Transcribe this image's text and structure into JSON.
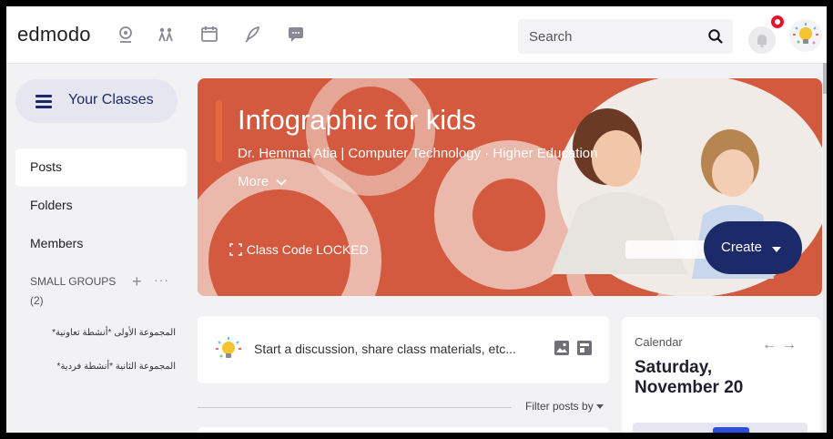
{
  "topbar": {
    "logo": "edmodo",
    "nav_icons": [
      "discover-icon",
      "network-icon",
      "calendar-icon",
      "rocket-icon",
      "chat-icon"
    ],
    "search": {
      "placeholder": "Search"
    },
    "colors": {
      "accent": "#1d2a6a",
      "notification": "#e2132d"
    }
  },
  "sidebar": {
    "your_classes": "Your Classes",
    "items": [
      {
        "label": "Posts",
        "active": true
      },
      {
        "label": "Folders",
        "active": false
      },
      {
        "label": "Members",
        "active": false
      }
    ],
    "small_groups": {
      "label": "SMALL GROUPS",
      "count": "(2)"
    },
    "groups": [
      "المجموعة الأولى *أنشطة تعاونية*",
      "المجموعة الثانية *أنشطة فردية*"
    ]
  },
  "banner": {
    "title": "Infographic for kids",
    "subtitle": "Dr. Hemmat Atia | Computer Technology  · Higher Education",
    "more": "More",
    "class_code": "Class Code LOCKED",
    "dots": "...",
    "create": "Create",
    "colors": {
      "background": "#d35a3f",
      "accent_bar": "#e8673c"
    }
  },
  "composer": {
    "placeholder": "Start a discussion, share class materials, etc..."
  },
  "filter": {
    "label": "Filter posts by"
  },
  "calendar": {
    "label": "Calendar",
    "day": "Saturday,",
    "date": "November 20"
  }
}
